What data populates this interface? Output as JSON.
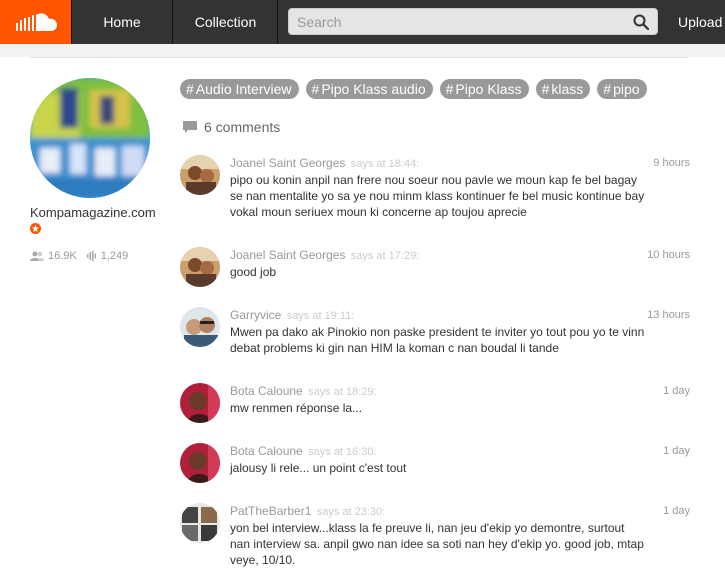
{
  "header": {
    "nav": {
      "home": "Home",
      "collection": "Collection",
      "upload": "Upload"
    },
    "search_placeholder": "Search"
  },
  "artist": {
    "name": "Kompamagazine.com",
    "followers": "16.9K",
    "tracks": "1,249"
  },
  "tags": [
    "Audio Interview",
    "Pipo Klass audio",
    "Pipo Klass",
    "klass",
    "pipo"
  ],
  "comments_count_label": "6 comments",
  "comments": [
    {
      "user": "Joanel Saint Georges",
      "says": "says at 18:44:",
      "ago": "9 hours",
      "lines": [
        "pipo ou konin anpil nan frere nou soeur nou pavle we moun kap fe bel bagay",
        "se nan mentalite yo sa ye nou minm klass kontinuer fe bel music kontinue bay",
        "vokal moun seriuex moun ki concerne ap toujou aprecie"
      ]
    },
    {
      "user": "Joanel Saint Georges",
      "says": "says at 17:29:",
      "ago": "10 hours",
      "lines": [
        "good job"
      ]
    },
    {
      "user": "Garryvice",
      "says": "says at 19:11:",
      "ago": "13 hours",
      "lines": [
        "Mwen pa dako ak Pinokio non paske president te inviter yo tout pou yo te vinn",
        "debat problems ki gin nan HIM la koman c nan boudal li tande"
      ]
    },
    {
      "user": "Bota Caloune",
      "says": "says at 18:29:",
      "ago": "1 day",
      "lines": [
        "mw renmen réponse la..."
      ]
    },
    {
      "user": "Bota Caloune",
      "says": "says at 16:30:",
      "ago": "1 day",
      "lines": [
        "jalousy li rele... un point c'est tout"
      ]
    },
    {
      "user": "PatTheBarber1",
      "says": "says at 23:30:",
      "ago": "1 day",
      "lines": [
        "yon bel interview...klass la fe preuve li, nan jeu d'ekip yo demontre, surtout",
        "nan interview sa. anpil gwo nan idee sa soti nan hey d'ekip yo. good job, mtap",
        "veye, 10/10."
      ]
    }
  ],
  "colors": {
    "brand": "#ff5500",
    "header_bg": "#333333",
    "tag_bg": "#999999"
  }
}
